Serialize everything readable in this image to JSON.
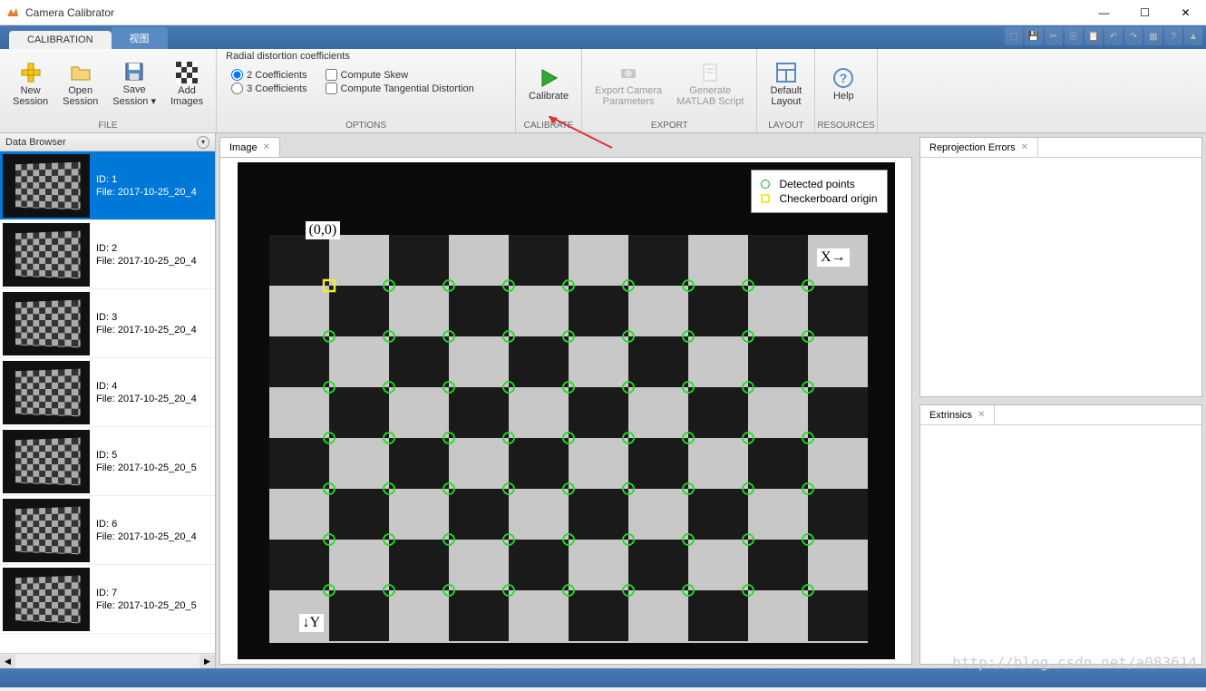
{
  "window": {
    "title": "Camera Calibrator",
    "min": "—",
    "max": "☐",
    "close": "✕"
  },
  "tabs": {
    "main": "CALIBRATION",
    "secondary": "视图"
  },
  "ribbon": {
    "file": {
      "label": "FILE",
      "new": "New\nSession",
      "open": "Open\nSession",
      "save": "Save\nSession ▾",
      "add": "Add\nImages"
    },
    "options": {
      "label": "OPTIONS",
      "title": "Radial distortion coefficients",
      "r2": "2 Coefficients",
      "r3": "3 Coefficients",
      "skew": "Compute Skew",
      "tang": "Compute Tangential Distortion"
    },
    "calibrate": {
      "label": "CALIBRATE",
      "btn": "Calibrate"
    },
    "export": {
      "label": "EXPORT",
      "exp": "Export Camera\nParameters",
      "gen": "Generate\nMATLAB Script"
    },
    "layout": {
      "label": "LAYOUT",
      "btn": "Default\nLayout"
    },
    "resources": {
      "label": "RESOURCES",
      "help": "Help"
    }
  },
  "browser": {
    "title": "Data Browser",
    "items": [
      {
        "id": "ID: 1",
        "file": "File: 2017-10-25_20_4"
      },
      {
        "id": "ID: 2",
        "file": "File: 2017-10-25_20_4"
      },
      {
        "id": "ID: 3",
        "file": "File: 2017-10-25_20_4"
      },
      {
        "id": "ID: 4",
        "file": "File: 2017-10-25_20_4"
      },
      {
        "id": "ID: 5",
        "file": "File: 2017-10-25_20_5"
      },
      {
        "id": "ID: 6",
        "file": "File: 2017-10-25_20_4"
      },
      {
        "id": "ID: 7",
        "file": "File: 2017-10-25_20_5"
      }
    ]
  },
  "center": {
    "tab": "Image",
    "legend": {
      "detected": "Detected points",
      "origin": "Checkerboard origin"
    },
    "annot": {
      "origin": "(0,0)",
      "x": "X→",
      "y": "↓Y"
    }
  },
  "right": {
    "panel1": "Reprojection Errors",
    "panel2": "Extrinsics"
  },
  "watermark": "http://blog.csdn.net/a083614"
}
